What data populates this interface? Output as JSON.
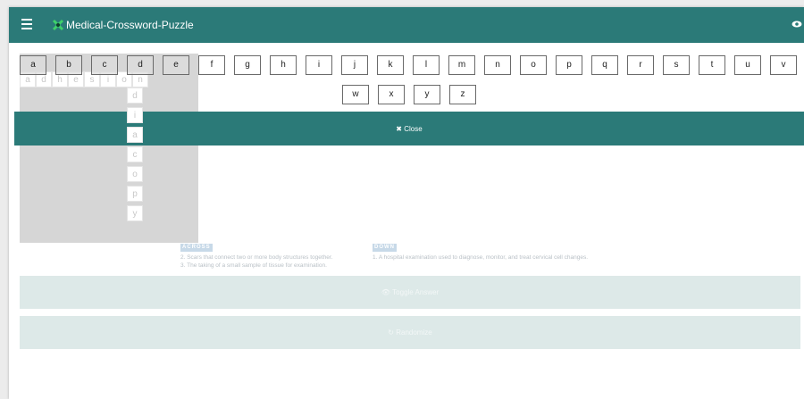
{
  "app": {
    "title": "Medical-Crossword-Puzzle"
  },
  "icons": {
    "menu": "menu-icon",
    "logo": "puzzle-logo-icon",
    "view": "eye-icon",
    "close": "close-icon",
    "toggle": "eye-icon",
    "randomize": "refresh-icon"
  },
  "colors": {
    "header": "#2b7a78",
    "close_bar": "#2b7a78"
  },
  "keyboard": {
    "row1": [
      "a",
      "b",
      "c",
      "d",
      "e",
      "f",
      "g",
      "h",
      "i",
      "j",
      "k",
      "l",
      "m",
      "n",
      "o",
      "p",
      "q",
      "r",
      "s",
      "t",
      "u",
      "v"
    ],
    "row2": [
      "w",
      "x",
      "y",
      "z"
    ],
    "close_label": "Close"
  },
  "grid": {
    "row_letters": [
      "a",
      "d",
      "h",
      "e",
      "s",
      "i",
      "o",
      "n"
    ],
    "col_letters": [
      "d",
      "i",
      "a",
      "c",
      "o",
      "p",
      "y"
    ]
  },
  "clues": {
    "across_heading": "ACROSS",
    "across": [
      "2. Scars that connect two or more body structures together.",
      "3. The taking of a small sample of tissue for examination."
    ],
    "down_heading": "DOWN",
    "down": [
      "1. A hospital examination used to diagnose, monitor, and treat cervical cell changes."
    ]
  },
  "actions": {
    "toggle_answer": "Toggle Answer",
    "randomize": "Randomize"
  }
}
